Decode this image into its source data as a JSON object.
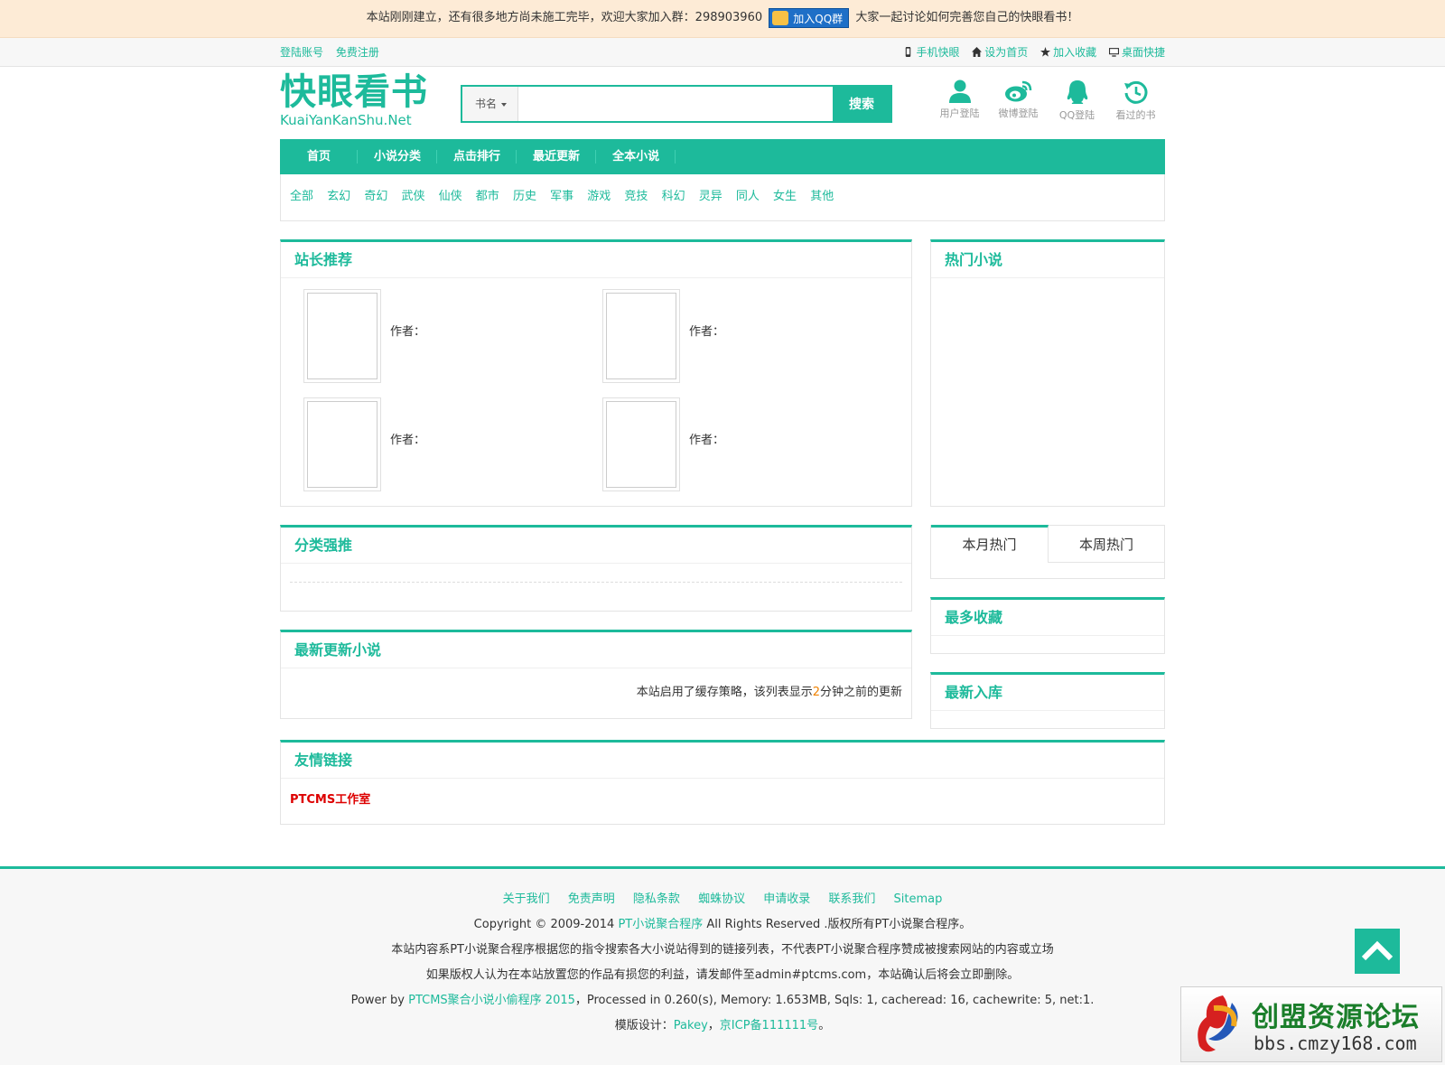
{
  "notice": {
    "text_before": "本站刚刚建立，还有很多地方尚未施工完毕，欢迎大家加入群：298903960",
    "qq_button": "加入QQ群",
    "text_after": "大家一起讨论如何完善您自己的快眼看书！"
  },
  "topbar": {
    "login": "登陆账号",
    "register": "免费注册",
    "mobile": "手机快眼",
    "set_home": "设为首页",
    "favorite": "加入收藏",
    "desktop": "桌面快捷"
  },
  "logo": {
    "cn": "快眼看书",
    "en": "KuaiYanKanShu.Net"
  },
  "search": {
    "type": "书名",
    "button": "搜索",
    "value": ""
  },
  "user_links": [
    {
      "label": "用户登陆",
      "icon": "user-icon"
    },
    {
      "label": "微博登陆",
      "icon": "weibo-icon"
    },
    {
      "label": "QQ登陆",
      "icon": "qq-icon"
    },
    {
      "label": "看过的书",
      "icon": "history-icon"
    }
  ],
  "nav": [
    "首页",
    "小说分类",
    "点击排行",
    "最近更新",
    "全本小说"
  ],
  "categories": [
    "全部",
    "玄幻",
    "奇幻",
    "武侠",
    "仙侠",
    "都市",
    "历史",
    "军事",
    "游戏",
    "竞技",
    "科幻",
    "灵异",
    "同人",
    "女生",
    "其他"
  ],
  "recommend": {
    "title": "站长推荐",
    "author_label": "作者："
  },
  "hot": {
    "title": "热门小说"
  },
  "category_push": {
    "title": "分类强推"
  },
  "tabs": {
    "month": "本月热门",
    "week": "本周热门"
  },
  "most_fav": {
    "title": "最多收藏"
  },
  "latest_update": {
    "title": "最新更新小说",
    "note_before": "本站启用了缓存策略，该列表显示",
    "note_num": "2",
    "note_after": "分钟之前的更新"
  },
  "newest": {
    "title": "最新入库"
  },
  "friend_links": {
    "title": "友情链接",
    "items": [
      "PTCMS工作室"
    ]
  },
  "footer": {
    "links": [
      "关于我们",
      "免责声明",
      "隐私条款",
      "蜘蛛协议",
      "申请收录",
      "联系我们",
      "Sitemap"
    ],
    "copyright_before": "Copyright © 2009-2014 ",
    "copyright_link": "PT小说聚合程序",
    "copyright_after": " All Rights Reserved .版权所有PT小说聚合程序。",
    "disclaimer": "本站内容系PT小说聚合程序根据您的指令搜索各大小说站得到的链接列表，不代表PT小说聚合程序赞成被搜索网站的内容或立场",
    "contact": "如果版权人认为在本站放置您的作品有损您的利益，请发邮件至admin#ptcms.com，本站确认后将会立即删除。",
    "power_before": "Power by ",
    "power_link": "PTCMS聚合小说小偷程序 2015",
    "power_after": "，Processed in 0.260(s), Memory: 1.653MB, Sqls: 1, cacheread: 16, cachewrite: 5, net:1.",
    "design_label": "模版设计：",
    "design_link": "Pakey",
    "sep": "，",
    "icp": "京ICP备111111号",
    "end": "。"
  },
  "watermark": {
    "cn": "创盟资源论坛",
    "en": "bbs.cmzy168.com"
  }
}
